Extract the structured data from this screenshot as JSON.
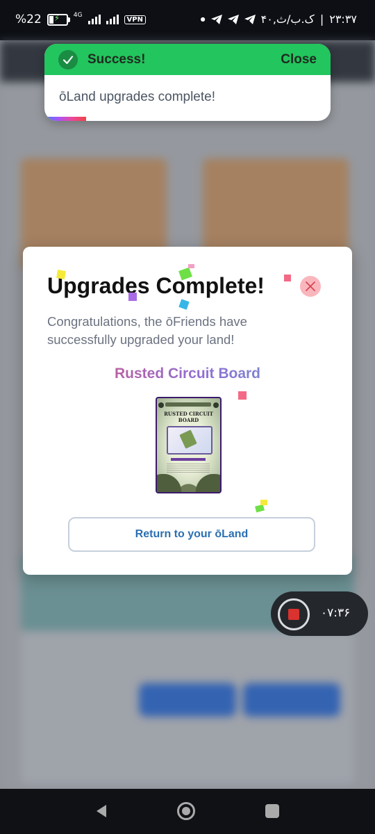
{
  "status_bar": {
    "battery_percent": "%22",
    "network_type": "4G",
    "vpn_label": "VPN",
    "time": "۲۳:۳۷",
    "carrier_text": "۴۰,ک.ب/ث",
    "separator": "|"
  },
  "toast": {
    "title": "Success!",
    "close_label": "Close",
    "message": "ōLand upgrades complete!"
  },
  "modal": {
    "title": "Upgrades Complete!",
    "message": "Congratulations, the ōFriends have successfully upgraded your land!",
    "item_name": "Rusted Circuit Board",
    "card_title": "RUSTED CIRCUIT BOARD",
    "return_button": "Return to your ōLand"
  },
  "recording": {
    "elapsed": "۰۷:۳۶"
  },
  "colors": {
    "success_green": "#22c55e",
    "close_pink": "#f9b7bd",
    "button_text_blue": "#2a6fb2",
    "record_red": "#d9322f"
  },
  "icons": [
    "check-icon",
    "close-icon",
    "telegram-icon",
    "back-icon",
    "home-icon",
    "recents-icon",
    "record-stop-icon"
  ]
}
